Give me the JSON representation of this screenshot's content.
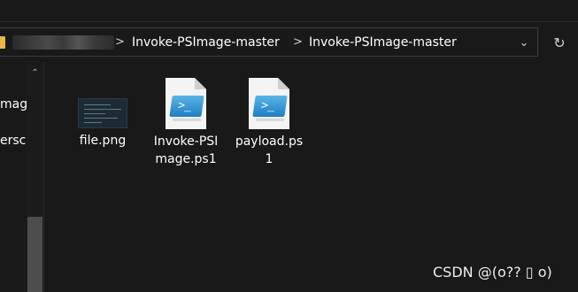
{
  "address": {
    "crumbs": [
      "Invoke-PSImage-master",
      "Invoke-PSImage-master"
    ],
    "separator": ">",
    "dropdown_icon": "⌄",
    "refresh_icon": "↻"
  },
  "nav": {
    "items": [
      "mage",
      "ersc"
    ],
    "scroll_up_icon": "⌃"
  },
  "files": [
    {
      "name": "file.png",
      "icon": "png-thumbnail-icon"
    },
    {
      "name": "Invoke-PSImage.ps1",
      "icon": "powershell-script-icon"
    },
    {
      "name": "payload.ps1",
      "icon": "powershell-script-icon"
    }
  ],
  "ps_glyph": ">_",
  "watermark": "CSDN @(o?? ▯ o)",
  "colors": {
    "background": "#191919",
    "folder": "#e8b84a",
    "powershell_blue": "#1f7fc1"
  }
}
